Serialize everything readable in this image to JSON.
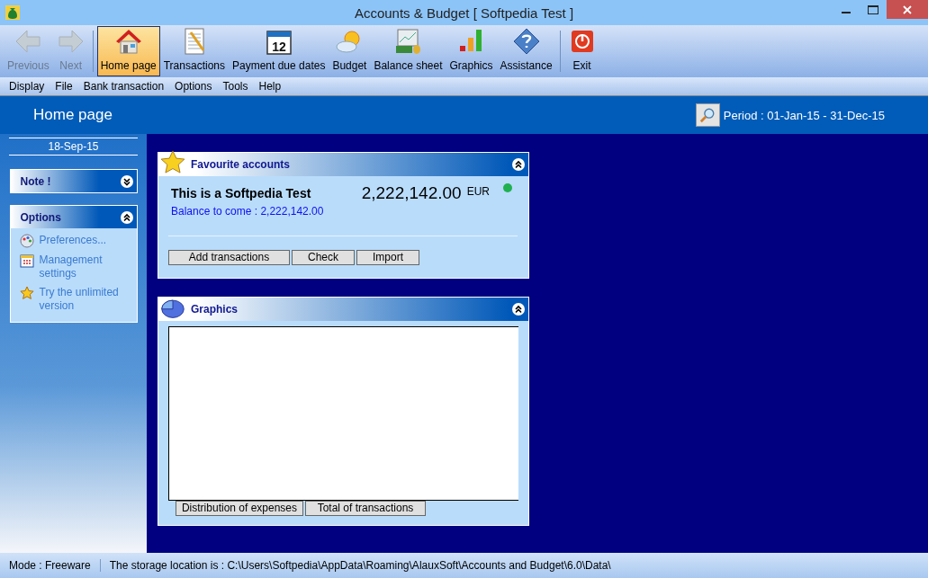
{
  "window": {
    "title": "Accounts & Budget [ Softpedia Test ]"
  },
  "toolbar": [
    {
      "label": "Previous",
      "kind": "back",
      "disabled": true,
      "selected": false
    },
    {
      "label": "Next",
      "kind": "forward",
      "disabled": true,
      "selected": false
    },
    {
      "label": "Home page",
      "kind": "house",
      "disabled": false,
      "selected": true
    },
    {
      "label": "Transactions",
      "kind": "notepad",
      "disabled": false,
      "selected": false
    },
    {
      "label": "Payment due dates",
      "kind": "calendar",
      "disabled": false,
      "selected": false
    },
    {
      "label": "Budget",
      "kind": "weather",
      "disabled": false,
      "selected": false
    },
    {
      "label": "Balance sheet",
      "kind": "money",
      "disabled": false,
      "selected": false
    },
    {
      "label": "Graphics",
      "kind": "bars",
      "disabled": false,
      "selected": false
    },
    {
      "label": "Assistance",
      "kind": "help",
      "disabled": false,
      "selected": false
    },
    {
      "label": "Exit",
      "kind": "power",
      "disabled": false,
      "selected": false
    }
  ],
  "calendar_day": "12",
  "menu": [
    "Display",
    "File",
    "Bank transaction",
    "Options",
    "Tools",
    "Help"
  ],
  "header": {
    "title": "Home page",
    "period": "Period : 01-Jan-15 - 31-Dec-15"
  },
  "sidebar": {
    "date": "18-Sep-15",
    "panels": [
      {
        "title": "Note !",
        "expanded": false
      },
      {
        "title": "Options",
        "expanded": true,
        "items": [
          {
            "label": "Preferences...",
            "kind": "palette"
          },
          {
            "label": "Management settings",
            "kind": "grid"
          },
          {
            "label": "Try the unlimited version",
            "kind": "star"
          }
        ]
      }
    ]
  },
  "favourites": {
    "title": "Favourite accounts",
    "expanded": true,
    "account": "This is a Softpedia Test",
    "amount": "2,222,142.00",
    "currency": "EUR",
    "color": "#20b050",
    "balance_to_come": "Balance to come : 2,222,142.00",
    "buttons": [
      "Add transactions",
      "Check",
      "Import"
    ]
  },
  "graphics": {
    "title": "Graphics",
    "expanded": true,
    "buttons": [
      "Distribution of expenses",
      "Total of transactions"
    ]
  },
  "status_bar": {
    "mode": "Mode : Freeware",
    "storage": "The storage location is : C:\\Users\\Softpedia\\AppData\\Roaming\\AlauxSoft\\Accounts and Budget\\6.0\\Data\\"
  }
}
